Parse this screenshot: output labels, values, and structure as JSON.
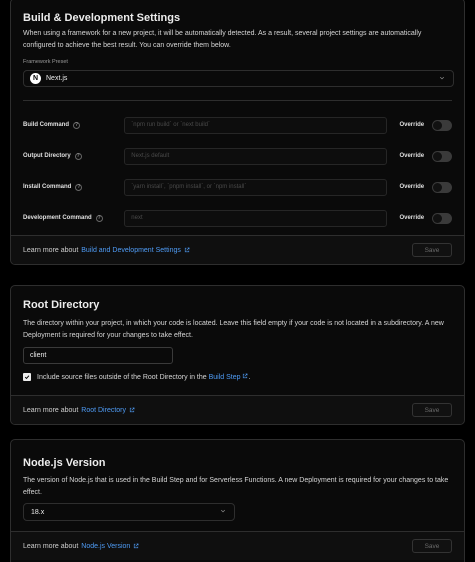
{
  "build": {
    "title": "Build & Development Settings",
    "description": "When using a framework for a new project, it will be automatically detected. As a result, several project settings are automatically configured to achieve the best result. You can override them below.",
    "preset_label": "Framework Preset",
    "preset_value": "Next.js",
    "rows": [
      {
        "label": "Build Command",
        "placeholder": "`npm run build` or `next build`",
        "override": "Override"
      },
      {
        "label": "Output Directory",
        "placeholder": "Next.js default",
        "override": "Override"
      },
      {
        "label": "Install Command",
        "placeholder": "`yarn install`, `pnpm install`, or `npm install`",
        "override": "Override"
      },
      {
        "label": "Development Command",
        "placeholder": "next",
        "override": "Override"
      }
    ],
    "footer_prefix": "Learn more about",
    "footer_link": "Build and Development Settings",
    "save_label": "Save"
  },
  "root": {
    "title": "Root Directory",
    "description": "The directory within your project, in which your code is located. Leave this field empty if your code is not located in a subdirectory. A new Deployment is required for your changes to take effect.",
    "value": "client",
    "checkbox_text": "Include source files outside of the Root Directory in the",
    "checkbox_link": "Build Step",
    "checkbox_suffix": ".",
    "footer_prefix": "Learn more about",
    "footer_link": "Root Directory",
    "save_label": "Save"
  },
  "node": {
    "title": "Node.js Version",
    "description": "The version of Node.js that is used in the Build Step and for Serverless Functions. A new Deployment is required for your changes to take effect.",
    "value": "18.x",
    "footer_prefix": "Learn more about",
    "footer_link": "Node.js Version",
    "save_label": "Save"
  },
  "icons": {
    "help": "help-circle-icon",
    "external": "external-link-icon",
    "chevron": "chevron-down-icon",
    "check": "check-icon",
    "logo": "nextjs-logo-icon"
  },
  "colors": {
    "link": "#4f9cf6",
    "background": "#000000",
    "card": "#0a0a0a",
    "border": "#2e2e2e"
  }
}
